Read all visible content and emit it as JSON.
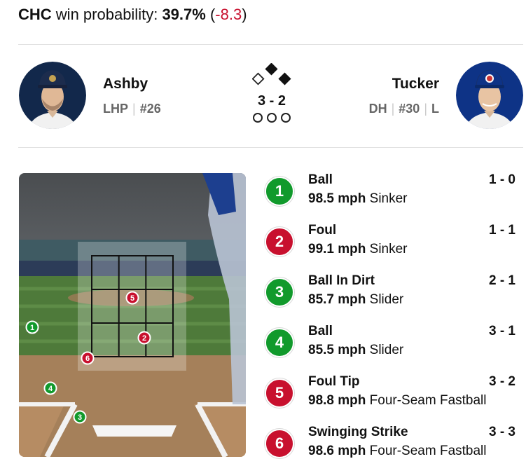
{
  "win_prob": {
    "team": "CHC",
    "label": "win probability:",
    "value": "39.7%",
    "delta_open": "(",
    "delta": "-8.3",
    "delta_close": ")"
  },
  "matchup": {
    "pitcher": {
      "name": "Ashby",
      "position": "LHP",
      "number": "#26",
      "team_color": "#12284b"
    },
    "batter": {
      "name": "Tucker",
      "position": "DH",
      "number": "#30",
      "bats": "L",
      "team_color": "#0e3386"
    },
    "count": "3 - 2",
    "outs": 0,
    "runners": {
      "first": false,
      "second": true,
      "third": false
    }
  },
  "colors": {
    "ball": "#119a2c",
    "strike": "#c8102e"
  },
  "pitches": [
    {
      "num": "1",
      "type": "ball",
      "result": "Ball",
      "count": "1 - 0",
      "speed": "98.5 mph",
      "pitch": "Sinker"
    },
    {
      "num": "2",
      "type": "strike",
      "result": "Foul",
      "count": "1 - 1",
      "speed": "99.1 mph",
      "pitch": "Sinker"
    },
    {
      "num": "3",
      "type": "ball",
      "result": "Ball In Dirt",
      "count": "2 - 1",
      "speed": "85.7 mph",
      "pitch": "Slider"
    },
    {
      "num": "4",
      "type": "ball",
      "result": "Ball",
      "count": "3 - 1",
      "speed": "85.5 mph",
      "pitch": "Slider"
    },
    {
      "num": "5",
      "type": "strike",
      "result": "Foul Tip",
      "count": "3 - 2",
      "speed": "98.8 mph",
      "pitch": "Four-Seam Fastball"
    },
    {
      "num": "6",
      "type": "strike",
      "result": "Swinging Strike",
      "count": "3 - 3",
      "speed": "98.6 mph",
      "pitch": "Four-Seam Fastball"
    }
  ]
}
